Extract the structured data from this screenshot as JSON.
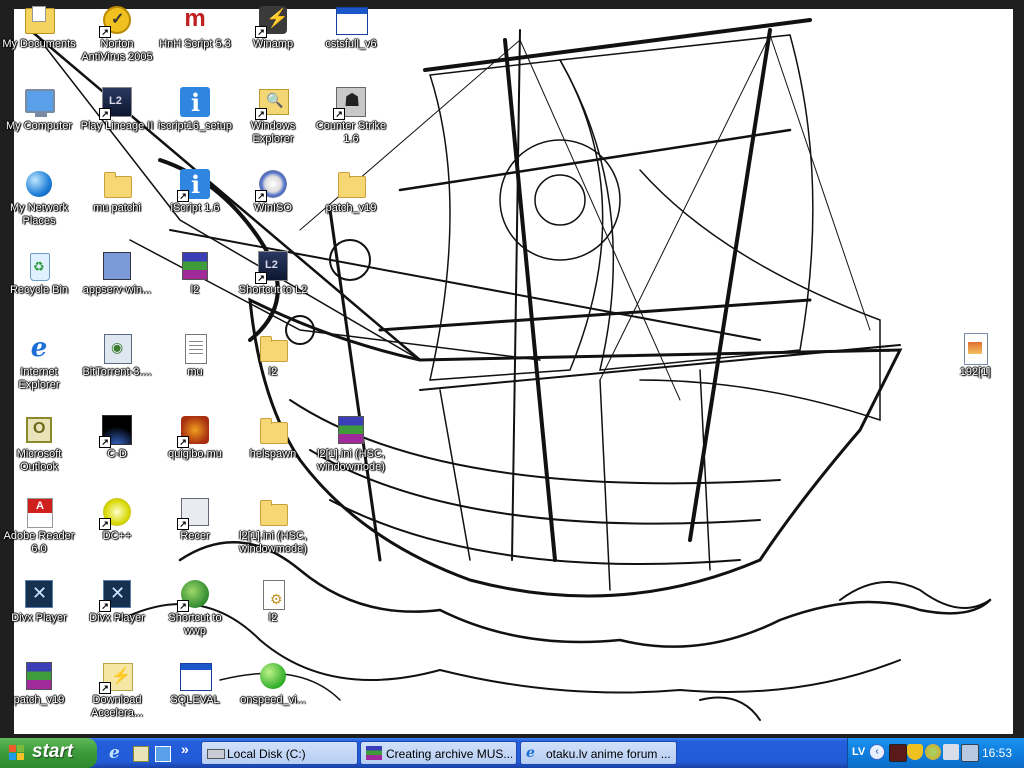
{
  "desktop": {
    "columns": [
      [
        {
          "label": "My Documents",
          "icon": "my-documents-icon",
          "shortcut": false
        },
        {
          "label": "My Computer",
          "icon": "my-computer-icon",
          "shortcut": false
        },
        {
          "label": "My Network Places",
          "icon": "network-places-icon",
          "shortcut": false
        },
        {
          "label": "Recycle Bin",
          "icon": "recycle-bin-icon",
          "shortcut": false
        },
        {
          "label": "Internet Explorer",
          "icon": "internet-explorer-icon",
          "shortcut": false
        },
        {
          "label": "Microsoft Outlook",
          "icon": "outlook-icon",
          "shortcut": false
        },
        {
          "label": "Adobe Reader 6.0",
          "icon": "adobe-reader-icon",
          "shortcut": false
        },
        {
          "label": "Divx Player",
          "icon": "divx-player-icon",
          "shortcut": false
        },
        {
          "label": "patch_v19",
          "icon": "winrar-archive-icon",
          "shortcut": false
        }
      ],
      [
        {
          "label": "Norton AntiVirus 2005",
          "icon": "norton-antivirus-icon",
          "shortcut": true
        },
        {
          "label": "Play Lineage II",
          "icon": "lineage-ii-icon",
          "shortcut": true
        },
        {
          "label": "mu patchi",
          "icon": "folder-icon",
          "shortcut": false
        },
        {
          "label": "appserv-win...",
          "icon": "appserv-installer-icon",
          "shortcut": false
        },
        {
          "label": "BitTorrent-3....",
          "icon": "bittorrent-installer-icon",
          "shortcut": false
        },
        {
          "label": "C-D",
          "icon": "cd-app-icon",
          "shortcut": true
        },
        {
          "label": "DC++",
          "icon": "dcplusplus-icon",
          "shortcut": true
        },
        {
          "label": "Divx Player",
          "icon": "divx-player-icon",
          "shortcut": true
        },
        {
          "label": "Download Accelera...",
          "icon": "download-accelerator-icon",
          "shortcut": true
        }
      ],
      [
        {
          "label": "HnH Script 5.3",
          "icon": "hnh-script-icon",
          "shortcut": false
        },
        {
          "label": "iscript16_setup",
          "icon": "iscript-setup-icon",
          "shortcut": false
        },
        {
          "label": "iScript 1.6",
          "icon": "iscript-icon",
          "shortcut": true
        },
        {
          "label": "l2",
          "icon": "winrar-archive-icon",
          "shortcut": false
        },
        {
          "label": "mu",
          "icon": "text-document-icon",
          "shortcut": false
        },
        {
          "label": "quigibo.mu",
          "icon": "quigibo-icon",
          "shortcut": true
        },
        {
          "label": "Recer",
          "icon": "recorder-icon",
          "shortcut": true
        },
        {
          "label": "Shortcut to wwp",
          "icon": "wwp-globe-icon",
          "shortcut": true
        },
        {
          "label": "SQLEVAL",
          "icon": "application-window-icon",
          "shortcut": false
        }
      ],
      [
        {
          "label": "Winamp",
          "icon": "winamp-icon",
          "shortcut": true
        },
        {
          "label": "Windows Explorer",
          "icon": "windows-explorer-icon",
          "shortcut": true
        },
        {
          "label": "WinISO",
          "icon": "winiso-icon",
          "shortcut": true
        },
        {
          "label": "Shortcut to L2",
          "icon": "lineage-ii-icon",
          "shortcut": true
        },
        {
          "label": "l2",
          "icon": "folder-icon",
          "shortcut": false
        },
        {
          "label": "helspawn",
          "icon": "folder-icon",
          "shortcut": false
        },
        {
          "label": "l2[1].ini (HSC, windowmode)",
          "icon": "folder-icon",
          "shortcut": false
        },
        {
          "label": "l2",
          "icon": "ini-settings-icon",
          "shortcut": false
        },
        {
          "label": "onspeed_vi...",
          "icon": "onspeed-icon",
          "shortcut": false
        }
      ],
      [
        {
          "label": "cstsfull_v6",
          "icon": "application-window-icon",
          "shortcut": false
        },
        {
          "label": "Counter Strike 1.6",
          "icon": "counter-strike-icon",
          "shortcut": true
        },
        {
          "label": "patch_v19",
          "icon": "folder-icon",
          "shortcut": false
        },
        null,
        null,
        {
          "label": "l2[1].ini (HSC, windowmode)",
          "icon": "winrar-archive-icon",
          "shortcut": false
        }
      ]
    ],
    "right_icon": {
      "label": "192[1]",
      "icon": "image-file-icon"
    }
  },
  "taskbar": {
    "start_label": "start",
    "quick_launch": [
      {
        "name": "internet-explorer-quicklaunch",
        "icon": "internet-explorer-icon"
      },
      {
        "name": "show-desktop-quicklaunch",
        "icon": "show-desktop-icon"
      },
      {
        "name": "outlook-quicklaunch",
        "icon": "outlook-express-icon"
      }
    ],
    "quick_launch_more": "»",
    "tasks": [
      {
        "label": "Local Disk (C:)",
        "icon": "drive-icon"
      },
      {
        "label": "Creating archive MUS...",
        "icon": "winrar-archive-icon"
      },
      {
        "label": "otaku.lv anime forum ...",
        "icon": "internet-explorer-icon"
      }
    ],
    "tray": {
      "language": "LV",
      "hide_toggle": "‹",
      "icons": [
        "tray-app-red-icon",
        "security-shield-icon",
        "messenger-icon",
        "volume-icon",
        "network-icon",
        "green-status-icon"
      ],
      "clock": "16:53"
    }
  },
  "colors": {
    "taskbar_blue": "#245edc",
    "start_green": "#3c9a3a",
    "tray_blue": "#0f7fe0"
  }
}
